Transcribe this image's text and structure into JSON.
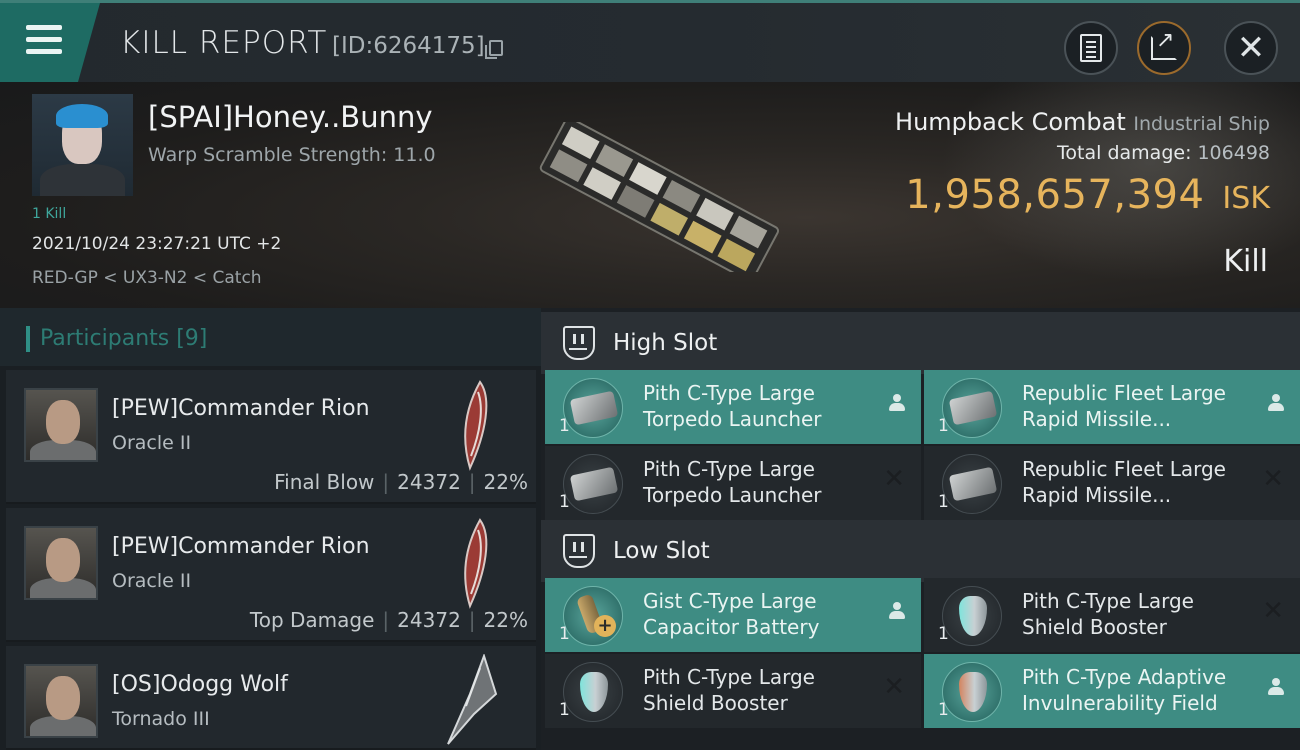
{
  "header": {
    "title": "KILL REPORT",
    "report_id": "[ID:6264175]",
    "icons": [
      "menu-icon",
      "copy-icon",
      "document-icon",
      "share-icon",
      "close-icon"
    ]
  },
  "victim": {
    "name": "[SPAI]Honey..Bunny",
    "warp_scramble": "Warp Scramble Strength: 11.0",
    "kill_count": "1 Kill",
    "datetime": "2021/10/24 23:27:21 UTC +2",
    "location": "RED-GP < UX3-N2 < Catch",
    "ship_name": "Humpback Combat",
    "ship_class": "Industrial Ship",
    "total_damage_label": "Total damage:",
    "total_damage": "106498",
    "isk_value": "1,958,657,394",
    "isk_unit": "ISK",
    "result": "Kill"
  },
  "participants": {
    "title": "Participants [9]",
    "rows": [
      {
        "name": "[PEW]Commander Rion",
        "ship": "Oracle II",
        "role": "Final Blow",
        "damage": "24372",
        "percent": "22%"
      },
      {
        "name": "[PEW]Commander Rion",
        "ship": "Oracle II",
        "role": "Top Damage",
        "damage": "24372",
        "percent": "22%"
      },
      {
        "name": "[OS]Odogg Wolf",
        "ship": "Tornado III",
        "role": "",
        "damage": "",
        "percent": ""
      }
    ]
  },
  "fitting": {
    "high_slot": {
      "title": "High Slot",
      "modules": [
        {
          "qty": "1",
          "line1": "Pith C-Type Large",
          "line2": "Torpedo Launcher",
          "dropped": true,
          "icon": "torpedo-launcher-icon"
        },
        {
          "qty": "1",
          "line1": "Republic Fleet Large",
          "line2": "Rapid Missile...",
          "dropped": true,
          "icon": "missile-launcher-icon"
        },
        {
          "qty": "1",
          "line1": "Pith C-Type Large",
          "line2": "Torpedo Launcher",
          "dropped": false,
          "icon": "torpedo-launcher-icon"
        },
        {
          "qty": "1",
          "line1": "Republic Fleet Large",
          "line2": "Rapid Missile...",
          "dropped": false,
          "icon": "missile-launcher-icon"
        }
      ]
    },
    "low_slot": {
      "title": "Low Slot",
      "modules": [
        {
          "qty": "1",
          "line1": "Gist C-Type Large",
          "line2": "Capacitor Battery",
          "dropped": true,
          "icon": "capacitor-battery-icon"
        },
        {
          "qty": "1",
          "line1": "Pith C-Type Large",
          "line2": "Shield Booster",
          "dropped": false,
          "icon": "shield-booster-icon"
        },
        {
          "qty": "1",
          "line1": "Pith C-Type Large",
          "line2": "Shield Booster",
          "dropped": false,
          "icon": "shield-booster-icon"
        },
        {
          "qty": "1",
          "line1": "Pith C-Type Adaptive",
          "line2": "Invulnerability Field",
          "dropped": true,
          "icon": "invulnerability-field-icon"
        }
      ]
    },
    "status_icons": {
      "dropped": "person-icon",
      "destroyed": "x-icon"
    }
  },
  "colors": {
    "accent": "#3e8c83",
    "isk": "#e6b45c",
    "background": "#15191d"
  }
}
